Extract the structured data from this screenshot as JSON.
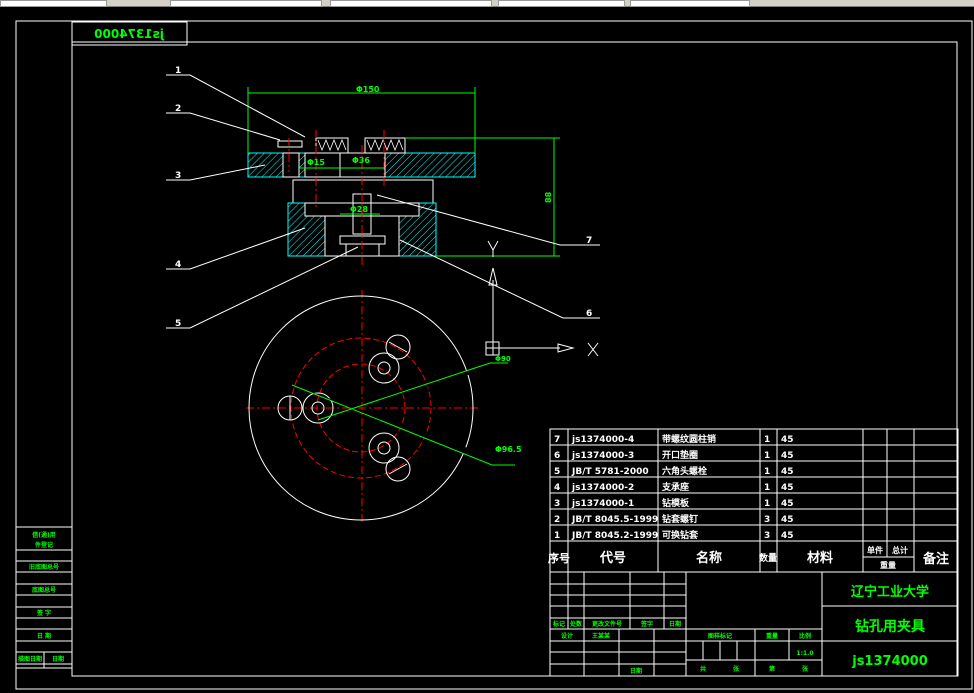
{
  "drawing": {
    "mirrored_code": "js1374000",
    "dimensions": {
      "width_dia": "Φ150",
      "height": "88",
      "bore1": "Φ15",
      "bore2": "Φ36",
      "bore3": "Φ28",
      "circle1": "Φ90",
      "circle2": "Φ96.5"
    },
    "balloons": [
      "1",
      "2",
      "3",
      "4",
      "5",
      "6",
      "7"
    ],
    "axes": {
      "x": "X",
      "y": "Y"
    }
  },
  "parts_list": {
    "rows": [
      {
        "no": "7",
        "code": "js1374000-4",
        "name": "带螺纹圆柱销",
        "qty": "1",
        "material": "45"
      },
      {
        "no": "6",
        "code": "js1374000-3",
        "name": "开口垫圈",
        "qty": "1",
        "material": "45"
      },
      {
        "no": "5",
        "code": "JB/T 5781-2000",
        "name": "六角头螺栓",
        "qty": "1",
        "material": "45"
      },
      {
        "no": "4",
        "code": "js1374000-2",
        "name": "支承座",
        "qty": "1",
        "material": "45"
      },
      {
        "no": "3",
        "code": "js1374000-1",
        "name": "钻模板",
        "qty": "1",
        "material": "45"
      },
      {
        "no": "2",
        "code": "JB/T 8045.5-1999",
        "name": "钻套螺钉",
        "qty": "3",
        "material": "45"
      },
      {
        "no": "1",
        "code": "JB/T 8045.2-1999",
        "name": "可换钻套",
        "qty": "3",
        "material": "45"
      }
    ],
    "header": {
      "no": "序号",
      "code": "代号",
      "name": "名称",
      "qty": "数量",
      "material": "材料",
      "unit": "单件",
      "total": "总计",
      "weight": "重量",
      "remark": "备注"
    }
  },
  "title_block": {
    "school": "辽宁工业大学",
    "title": "钻孔用夹具",
    "code": "js1374000",
    "mark": "标记",
    "count": "处数",
    "change_doc": "更改文件号",
    "sign": "签字",
    "date": "日期",
    "design": "设计",
    "designer": "王某某",
    "stage_mark": "图样标记",
    "weight": "重量",
    "scale": "比例",
    "scale_value": "1:1.0",
    "total_sheets": "共",
    "sheet": "张",
    "page": "第",
    "sheet2": "张",
    "check_date": "日期"
  },
  "left_strip": {
    "l1a": "借(通)用",
    "l1b": "件登记",
    "l2": "旧底图总号",
    "l3": "底图总号",
    "l4": "签 字",
    "l5": "日 期",
    "l6a": "描图日期",
    "l6b": "日期"
  },
  "colors": {
    "background": "#000000",
    "lines": "#ffffff",
    "dimension": "#00ff00",
    "centerline": "#ff0000",
    "hatch": "#00ffff"
  }
}
